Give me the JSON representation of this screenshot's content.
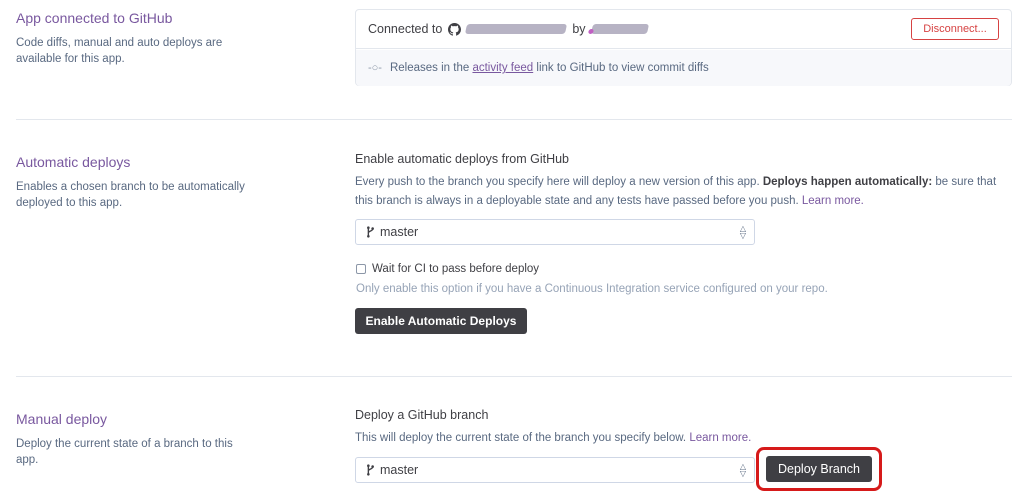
{
  "github_section": {
    "title": "App connected to GitHub",
    "description": "Code diffs, manual and auto deploys are available for this app.",
    "connected_prefix": "Connected to",
    "by_text": "by",
    "disconnect_label": "Disconnect...",
    "releases_prefix": "Releases in the",
    "activity_feed_link": "activity feed",
    "releases_suffix": "link to GitHub to view commit diffs"
  },
  "auto_deploy_section": {
    "title": "Automatic deploys",
    "description": "Enables a chosen branch to be automatically deployed to this app.",
    "heading": "Enable automatic deploys from GitHub",
    "body_text": "Every push to the branch you specify here will deploy a new version of this app.",
    "bold_text": "Deploys happen automatically:",
    "body_text_2": "be sure that this branch is always in a deployable state and any tests have passed before you push.",
    "learn_more": "Learn more.",
    "branch_value": "master",
    "ci_checkbox_label": "Wait for CI to pass before deploy",
    "ci_hint": "Only enable this option if you have a Continuous Integration service configured on your repo.",
    "enable_button_label": "Enable Automatic Deploys"
  },
  "manual_deploy_section": {
    "title": "Manual deploy",
    "description": "Deploy the current state of a branch to this app.",
    "heading": "Deploy a GitHub branch",
    "body_text": "This will deploy the current state of the branch you specify below.",
    "learn_more": "Learn more.",
    "branch_value": "master",
    "deploy_button_label": "Deploy Branch"
  },
  "colors": {
    "accent_purple": "#79589f",
    "dark_button": "#3f3f44",
    "danger_red": "#d64242",
    "highlight_ring": "#d61a1a"
  }
}
